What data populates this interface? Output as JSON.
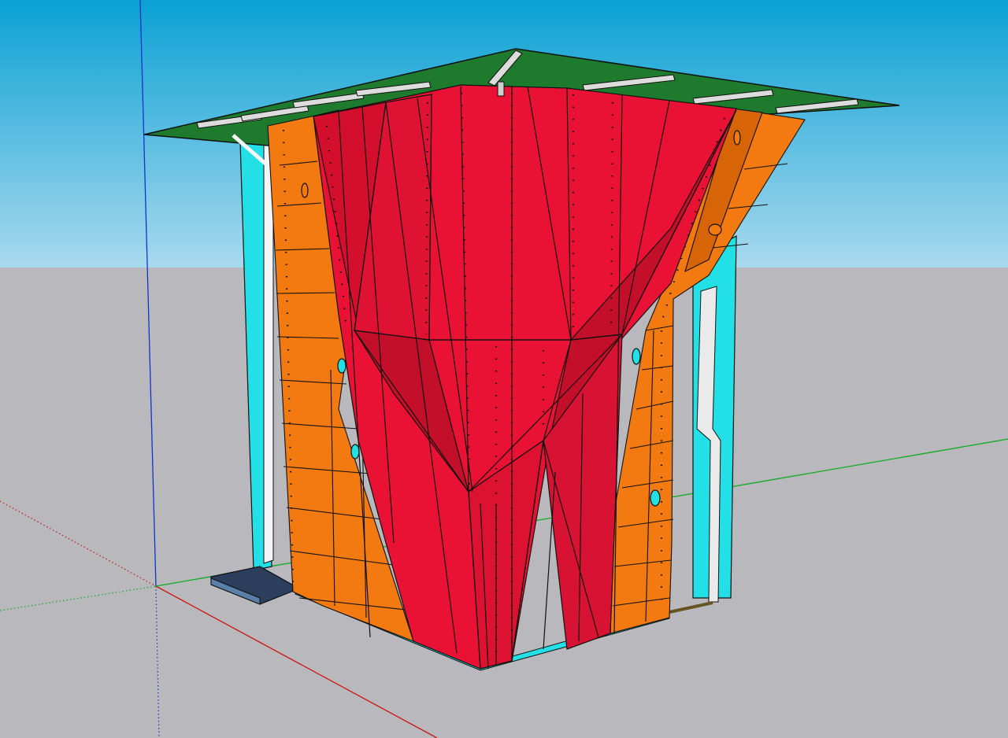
{
  "app": {
    "scene_description": "",
    "colors": {
      "sky_top": "#0aa1d4",
      "sky_horizon": "#a8d9ee",
      "ground": "#b9b9bd",
      "roof": "#1e7a2c",
      "main_wall": "#ea1234",
      "main_wall_dark": "#c40f2b",
      "side_wall": "#f27a10",
      "side_wall_dark": "#d86408",
      "frame": "#22e0e6",
      "base_pad": "#2b3f5c",
      "axis_red": "#cc1111",
      "axis_green": "#11aa22",
      "axis_blue": "#1133cc"
    },
    "icons": [
      "hold-icon"
    ]
  }
}
